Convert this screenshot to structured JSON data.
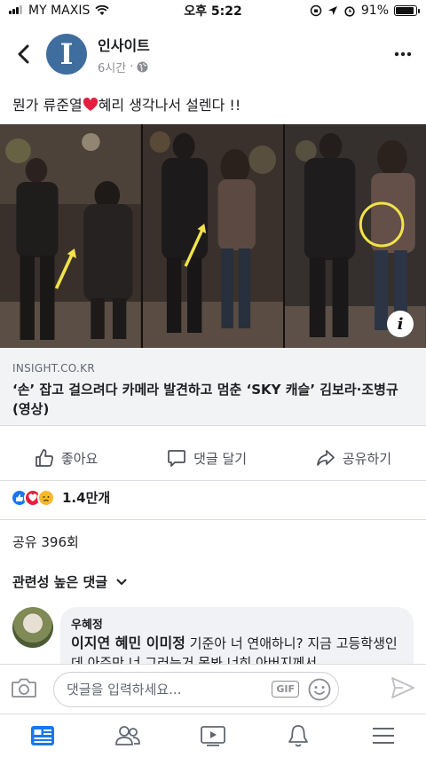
{
  "status_bar": {
    "carrier": "MY MAXIS",
    "time": "오후 5:22",
    "battery": "91%",
    "battery_level": 0.91
  },
  "post": {
    "page_name": "인사이트",
    "avatar_letter": "I",
    "time_ago": "6시간",
    "dot": "·",
    "text_before": "뭔가 류준열",
    "text_after": "혜리 생각나서 설렌다 !!",
    "link_domain": "INSIGHT.CO.KR",
    "link_title": "‘손’ 잡고 걸으려다 카메라 발견하고 멈춘 ‘SKY 캐슬’ 김보라·조병규 (영상)",
    "info_badge": "i"
  },
  "actions": {
    "like": "좋아요",
    "comment": "댓글 달기",
    "share": "공유하기"
  },
  "reactions": {
    "count": "1.4만개"
  },
  "shares": {
    "label": "공유 396회"
  },
  "comments": {
    "filter": "관련성 높은 댓글",
    "items": [
      {
        "author": "우혜정",
        "tags": "이지연 혜민 이미정",
        "text": " 기준아 너 연애하니? 지금 고등학생인데 아주만 너 그러는거 몸봐 너히 아버지께서"
      }
    ]
  },
  "composer": {
    "placeholder": "댓글을 입력하세요...",
    "gif_label": "GIF"
  },
  "colors": {
    "brand_blue": "#1877f2",
    "page_avatar": "#3f6e9e",
    "heart_red": "#e41e3f"
  },
  "icons": [
    "back-arrow-icon",
    "more-icon",
    "globe-icon",
    "heart-emoji-icon",
    "info-icon",
    "like-icon",
    "comment-icon",
    "share-icon",
    "like-reaction-icon",
    "love-reaction-icon",
    "sad-reaction-icon",
    "chevron-down-icon",
    "camera-icon",
    "sticker-icon",
    "send-icon",
    "news-feed-icon",
    "friends-icon",
    "watch-icon",
    "notifications-icon",
    "menu-icon"
  ]
}
